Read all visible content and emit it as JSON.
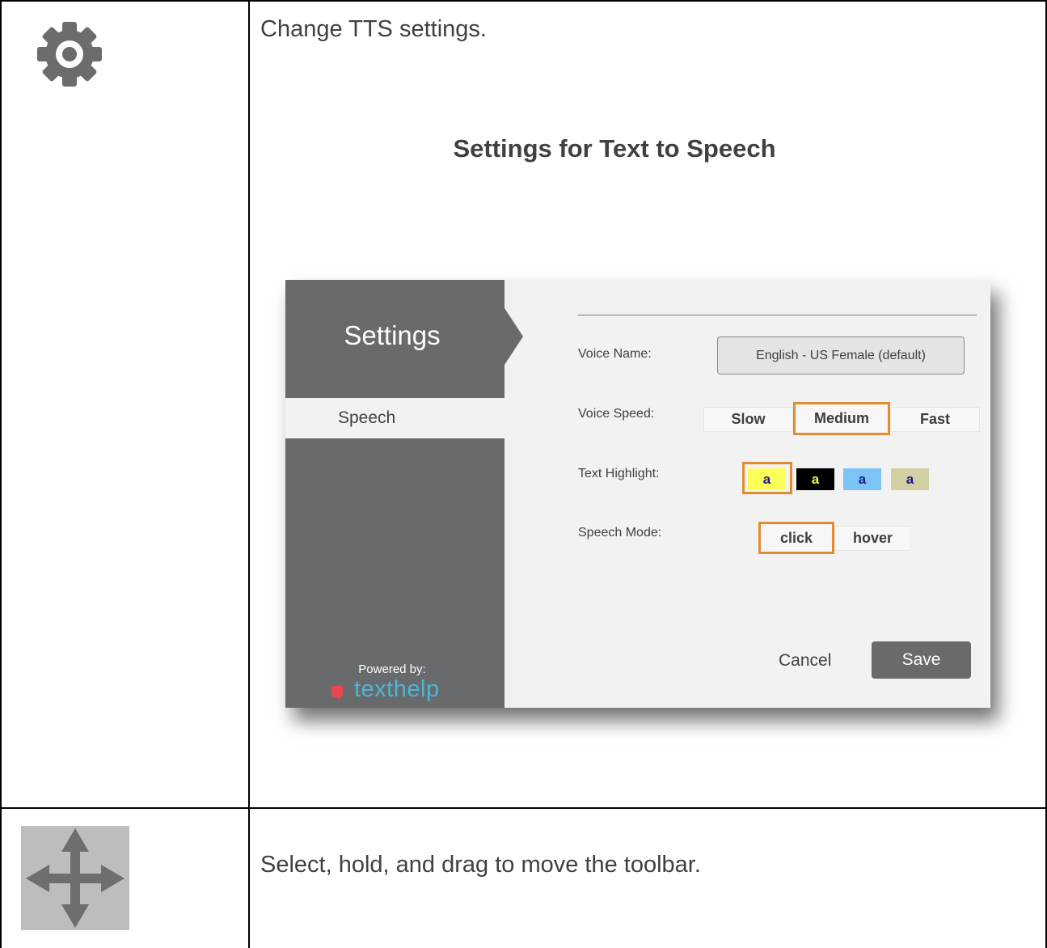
{
  "rows": [
    {
      "icon": "gear-icon",
      "description": "Change TTS settings.",
      "heading": "Settings for Text to Speech"
    },
    {
      "icon": "move-arrows-icon",
      "description": "Select, hold, and drag to move the toolbar."
    }
  ],
  "dialog": {
    "title": "Settings",
    "nav_items": [
      "Speech"
    ],
    "powered_by": "Powered by:",
    "brand": "texthelp",
    "fields": {
      "voice_name_label": "Voice Name:",
      "voice_name_value": "English - US Female (default)",
      "voice_speed_label": "Voice Speed:",
      "voice_speed_options": [
        "Slow",
        "Medium",
        "Fast"
      ],
      "voice_speed_selected": "Medium",
      "text_highlight_label": "Text Highlight:",
      "text_highlight_swatches": [
        {
          "text": "a",
          "bg": "#fcff57",
          "fg": "#1a1a8c",
          "selected": true
        },
        {
          "text": "a",
          "bg": "#000000",
          "fg": "#f5f542",
          "selected": false
        },
        {
          "text": "a",
          "bg": "#7cc4f5",
          "fg": "#1a1a8c",
          "selected": false
        },
        {
          "text": "a",
          "bg": "#d2d0a2",
          "fg": "#1a1a8c",
          "selected": false
        }
      ],
      "speech_mode_label": "Speech Mode:",
      "speech_mode_options": [
        "click",
        "hover"
      ],
      "speech_mode_selected": "click"
    },
    "cancel_label": "Cancel",
    "save_label": "Save"
  },
  "colors": {
    "sidebar": "#696a6c",
    "selection_outline": "#e28b2f",
    "brand": "#4cb6d6"
  }
}
